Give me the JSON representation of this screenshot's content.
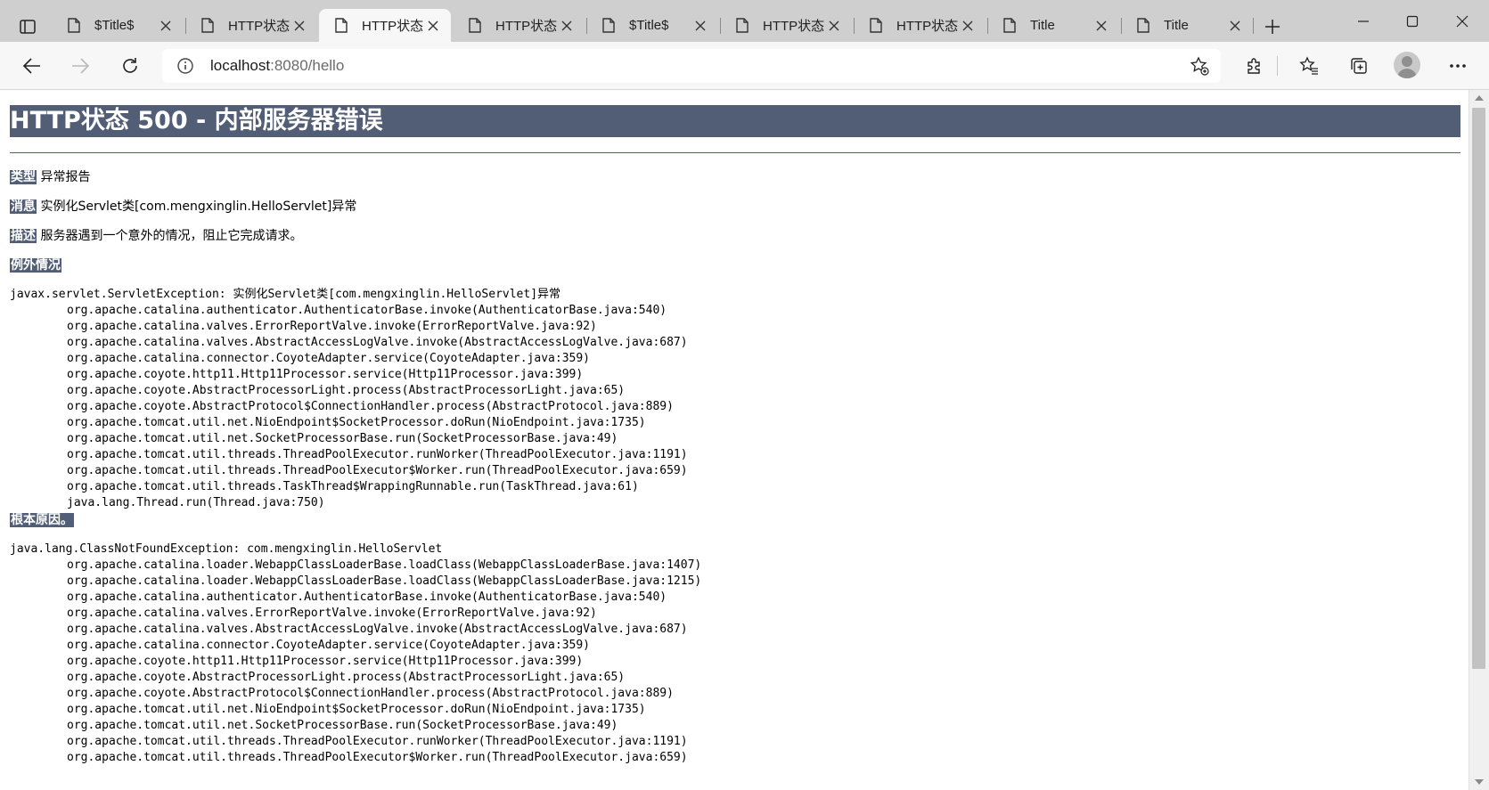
{
  "browser": {
    "tabs": [
      {
        "title": "$Title$",
        "active": false
      },
      {
        "title": "HTTP状态",
        "active": false
      },
      {
        "title": "HTTP状态",
        "active": true
      },
      {
        "title": "HTTP状态",
        "active": false
      },
      {
        "title": "$Title$",
        "active": false
      },
      {
        "title": "HTTP状态",
        "active": false
      },
      {
        "title": "HTTP状态",
        "active": false
      },
      {
        "title": "Title",
        "active": false
      },
      {
        "title": "Title",
        "active": false
      }
    ],
    "url_host": "localhost",
    "url_rest": ":8080/hello"
  },
  "page": {
    "title": "HTTP状态 500 - 内部服务器错误",
    "type_label": "类型",
    "type_value": "异常报告",
    "message_label": "消息",
    "message_value": "实例化Servlet类[com.mengxinglin.HelloServlet]异常",
    "description_label": "描述",
    "description_value": "服务器遇到一个意外的情况，阻止它完成请求。",
    "exception_label": "例外情况",
    "exception_head": "javax.servlet.ServletException: 实例化Servlet类[com.mengxinglin.HelloServlet]异常",
    "exception_frames": [
      "org.apache.catalina.authenticator.AuthenticatorBase.invoke(AuthenticatorBase.java:540)",
      "org.apache.catalina.valves.ErrorReportValve.invoke(ErrorReportValve.java:92)",
      "org.apache.catalina.valves.AbstractAccessLogValve.invoke(AbstractAccessLogValve.java:687)",
      "org.apache.catalina.connector.CoyoteAdapter.service(CoyoteAdapter.java:359)",
      "org.apache.coyote.http11.Http11Processor.service(Http11Processor.java:399)",
      "org.apache.coyote.AbstractProcessorLight.process(AbstractProcessorLight.java:65)",
      "org.apache.coyote.AbstractProtocol$ConnectionHandler.process(AbstractProtocol.java:889)",
      "org.apache.tomcat.util.net.NioEndpoint$SocketProcessor.doRun(NioEndpoint.java:1735)",
      "org.apache.tomcat.util.net.SocketProcessorBase.run(SocketProcessorBase.java:49)",
      "org.apache.tomcat.util.threads.ThreadPoolExecutor.runWorker(ThreadPoolExecutor.java:1191)",
      "org.apache.tomcat.util.threads.ThreadPoolExecutor$Worker.run(ThreadPoolExecutor.java:659)",
      "org.apache.tomcat.util.threads.TaskThread$WrappingRunnable.run(TaskThread.java:61)",
      "java.lang.Thread.run(Thread.java:750)"
    ],
    "root_cause_label": "根本原因。",
    "root_cause_head": "java.lang.ClassNotFoundException: com.mengxinglin.HelloServlet",
    "root_cause_frames": [
      "org.apache.catalina.loader.WebappClassLoaderBase.loadClass(WebappClassLoaderBase.java:1407)",
      "org.apache.catalina.loader.WebappClassLoaderBase.loadClass(WebappClassLoaderBase.java:1215)",
      "org.apache.catalina.authenticator.AuthenticatorBase.invoke(AuthenticatorBase.java:540)",
      "org.apache.catalina.valves.ErrorReportValve.invoke(ErrorReportValve.java:92)",
      "org.apache.catalina.valves.AbstractAccessLogValve.invoke(AbstractAccessLogValve.java:687)",
      "org.apache.catalina.connector.CoyoteAdapter.service(CoyoteAdapter.java:359)",
      "org.apache.coyote.http11.Http11Processor.service(Http11Processor.java:399)",
      "org.apache.coyote.AbstractProcessorLight.process(AbstractProcessorLight.java:65)",
      "org.apache.coyote.AbstractProtocol$ConnectionHandler.process(AbstractProtocol.java:889)",
      "org.apache.tomcat.util.net.NioEndpoint$SocketProcessor.doRun(NioEndpoint.java:1735)",
      "org.apache.tomcat.util.net.SocketProcessorBase.run(SocketProcessorBase.java:49)",
      "org.apache.tomcat.util.threads.ThreadPoolExecutor.runWorker(ThreadPoolExecutor.java:1191)",
      "org.apache.tomcat.util.threads.ThreadPoolExecutor$Worker.run(ThreadPoolExecutor.java:659)"
    ]
  },
  "colors": {
    "tomcat_header": "#525d76",
    "tabstrip": "#cfcfcf",
    "toolbar": "#f7f7f7"
  }
}
